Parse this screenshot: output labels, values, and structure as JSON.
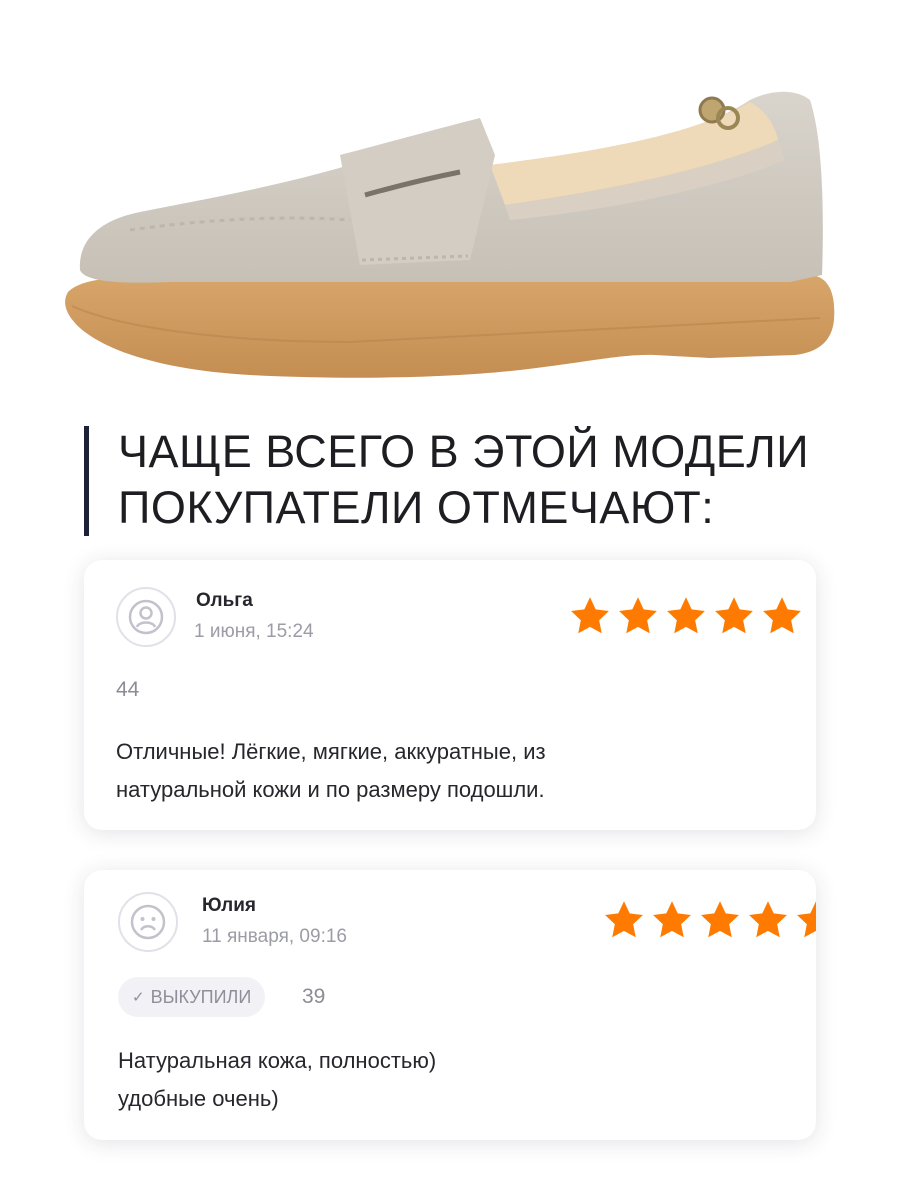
{
  "heading": {
    "line1": "ЧАЩЕ ВСЕГО В ЭТОЙ МОДЕЛИ",
    "line2": "ПОКУПАТЕЛИ ОТМЕЧАЮТ:"
  },
  "colors": {
    "accent_bar": "#1e2238",
    "star": "#ff7a00",
    "muted_text": "#9c9ca6"
  },
  "product_image": {
    "icon": "suede-loafer-photo"
  },
  "reviews": [
    {
      "name": "Ольга",
      "date": "1 июня, 15:24",
      "rating": 5,
      "likes": "44",
      "badge": "",
      "text_line1": "Отличные!  Лёгкие, мягкие, аккуратные, из",
      "text_line2": "натуральной кожи и по размеру подошли.",
      "avatar_icon": "user-avatar-icon"
    },
    {
      "name": "Юлия",
      "date": "11 января, 09:16",
      "rating": 5,
      "likes": "39",
      "badge": "ВЫКУПИЛИ",
      "badge_check": "✓",
      "text_line1": "Натуральная кожа, полностью)",
      "text_line2": "удобные очень)",
      "avatar_icon": "sad-face-avatar-icon"
    }
  ]
}
